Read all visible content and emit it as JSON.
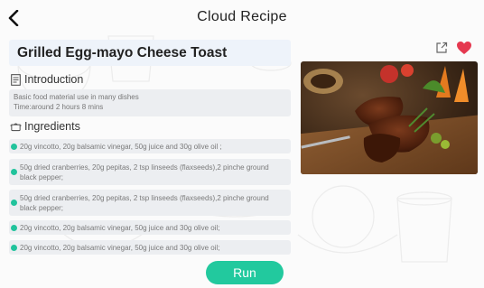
{
  "header": {
    "title": "Cloud Recipe",
    "back_icon": "chevron-left-icon"
  },
  "recipe": {
    "name": "Grilled Egg-mayo Cheese Toast",
    "share_icon": "share-icon",
    "favorite_icon": "heart-icon",
    "favorite_color": "#e53950",
    "image": "grilled-steak-photo"
  },
  "introduction": {
    "heading": "Introduction",
    "icon": "document-icon",
    "lines": [
      "Basic food material use in many dishes",
      "Time:around 2 hours 8 mins"
    ]
  },
  "ingredients": {
    "heading": "Ingredients",
    "icon": "pot-icon",
    "bullet_color": "#21c39c",
    "items": [
      "20g vincotto, 20g balsamic vinegar, 50g juice and 30g olive oil ;",
      "50g dried cranberries, 20g pepitas, 2 tsp linseeds  (flaxseeds),2 pinche ground black pepper;",
      "50g dried cranberries, 20g pepitas, 2 tsp linseeds  (flaxseeds),2 pinche ground black pepper;",
      "20g vincotto, 20g balsamic vinegar, 50g juice and 30g olive oil;",
      "20g vincotto, 20g balsamic vinegar, 50g juice and 30g olive oil;"
    ]
  },
  "actions": {
    "run_label": "Run",
    "accent": "#22c99e"
  }
}
